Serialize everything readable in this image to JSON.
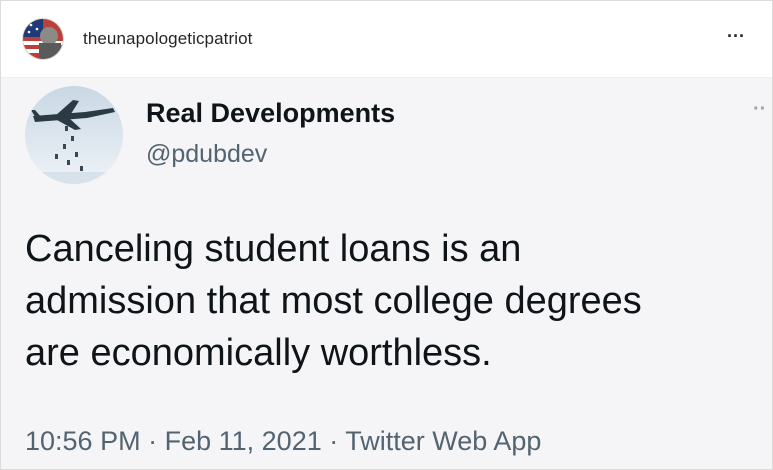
{
  "post": {
    "username": "theunapologeticpatriot",
    "more_icon": "more-horizontal-icon",
    "more_glyph": "···"
  },
  "tweet": {
    "display_name": "Real Developments",
    "handle": "@pdubdev",
    "more_glyph": "··",
    "text_lines": [
      "Canceling student loans is an",
      "admission that most college degrees",
      "are economically worthless."
    ],
    "time": "10:56 PM",
    "date": "Feb 11, 2021",
    "source": "Twitter Web App",
    "separator": "·"
  },
  "colors": {
    "text_primary": "#0f1419",
    "text_secondary": "#536471",
    "border": "#dbdbdb"
  }
}
